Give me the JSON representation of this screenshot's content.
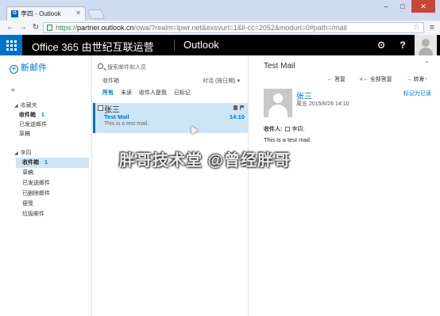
{
  "browser": {
    "tab_title": "李四 - Outlook",
    "url": {
      "scheme": "https://",
      "host": "partner.outlook.cn",
      "path": "/owa/?realm=lpwr.net&exsvurl=1&ll-cc=2052&modurl=0#path=/mail"
    }
  },
  "header": {
    "brand": "Office 365 由世纪互联运营",
    "app": "Outlook",
    "gear": "⚙",
    "help": "?"
  },
  "nav": {
    "new_mail": "新邮件",
    "collapse": "«",
    "favorites": {
      "title": "收藏夹",
      "items": [
        {
          "label": "收件箱",
          "count": "1"
        },
        {
          "label": "已发送邮件",
          "count": ""
        },
        {
          "label": "草稿",
          "count": ""
        }
      ]
    },
    "account": {
      "title": "李四",
      "items": [
        {
          "label": "收件箱",
          "count": "1"
        },
        {
          "label": "草稿",
          "count": ""
        },
        {
          "label": "已发送邮件",
          "count": ""
        },
        {
          "label": "已删除邮件",
          "count": ""
        },
        {
          "label": "便笺",
          "count": ""
        },
        {
          "label": "垃圾邮件",
          "count": ""
        }
      ]
    }
  },
  "list": {
    "search_placeholder": "搜索邮件和人员",
    "folder": "收件箱",
    "sort": "对话 (按日期)",
    "filters": [
      "所有",
      "未读",
      "收件人是我",
      "已标记"
    ],
    "message": {
      "sender": "张三",
      "subject": "Test Mail",
      "time": "14:10",
      "preview": "This is a test mail."
    }
  },
  "reading": {
    "subject": "Test Mail",
    "actions": [
      "答复",
      "全部答复",
      "转发"
    ],
    "more": "...",
    "from": "张三",
    "date": "周五 2015/6/26 14:10",
    "mark_read": "标记为已读",
    "to_label": "收件人:",
    "to_value": "李四;",
    "body": "This is a test mail."
  },
  "watermark": "胖哥技术堂 @曾经胖哥"
}
